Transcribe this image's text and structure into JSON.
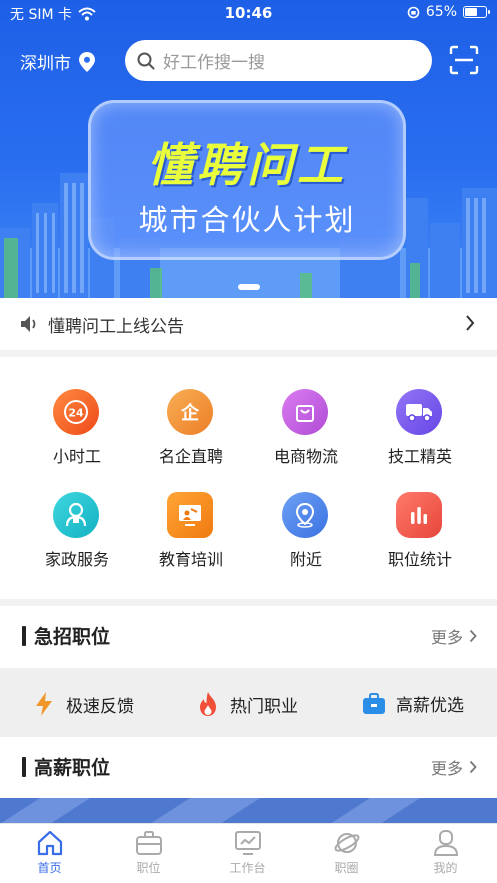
{
  "status": {
    "carrier": "无 SIM 卡",
    "time": "10:46",
    "battery": "65%",
    "battery_level": 0.65
  },
  "header": {
    "city": "深圳市",
    "search_placeholder": "好工作搜一搜"
  },
  "banner": {
    "title": "懂聘问工",
    "subtitle": "城市合伙人计划"
  },
  "notice": {
    "text": "懂聘问工上线公告"
  },
  "categories": [
    {
      "label": "小时工",
      "icon": "24h-clock-icon",
      "color": "#f26a2e",
      "badge": "24"
    },
    {
      "label": "名企直聘",
      "icon": "enterprise-icon",
      "color": "#f0963a",
      "badge": "企"
    },
    {
      "label": "电商物流",
      "icon": "shopping-bag-icon",
      "color": "#c75ee0"
    },
    {
      "label": "技工精英",
      "icon": "truck-icon",
      "color": "#7a5ef0"
    },
    {
      "label": "家政服务",
      "icon": "housekeeper-icon",
      "color": "#23c3cf"
    },
    {
      "label": "教育培训",
      "icon": "teacher-board-icon",
      "color": "#f58a1d"
    },
    {
      "label": "附近",
      "icon": "location-icon",
      "color": "#4e86ec"
    },
    {
      "label": "职位统计",
      "icon": "bar-stats-icon",
      "color": "#ef5a48"
    }
  ],
  "urgent": {
    "title": "急招职位",
    "more": "更多"
  },
  "features": [
    {
      "label": "极速反馈",
      "icon": "lightning-icon",
      "color": "#f0962a"
    },
    {
      "label": "热门职业",
      "icon": "flame-icon",
      "color": "#f0503a"
    },
    {
      "label": "高薪优选",
      "icon": "briefcase-icon",
      "color": "#2a8ee8"
    }
  ],
  "highpay": {
    "title": "高薪职位",
    "more": "更多"
  },
  "tabs": [
    {
      "label": "首页",
      "icon": "home-icon",
      "active": true
    },
    {
      "label": "职位",
      "icon": "briefcase-icon"
    },
    {
      "label": "工作台",
      "icon": "monitor-icon"
    },
    {
      "label": "职圈",
      "icon": "planet-icon"
    },
    {
      "label": "我的",
      "icon": "user-icon"
    }
  ],
  "colors": {
    "brand": "#2a6ef0",
    "active_tab": "#3a6ee8",
    "banner_title": "#e9ff3b"
  }
}
